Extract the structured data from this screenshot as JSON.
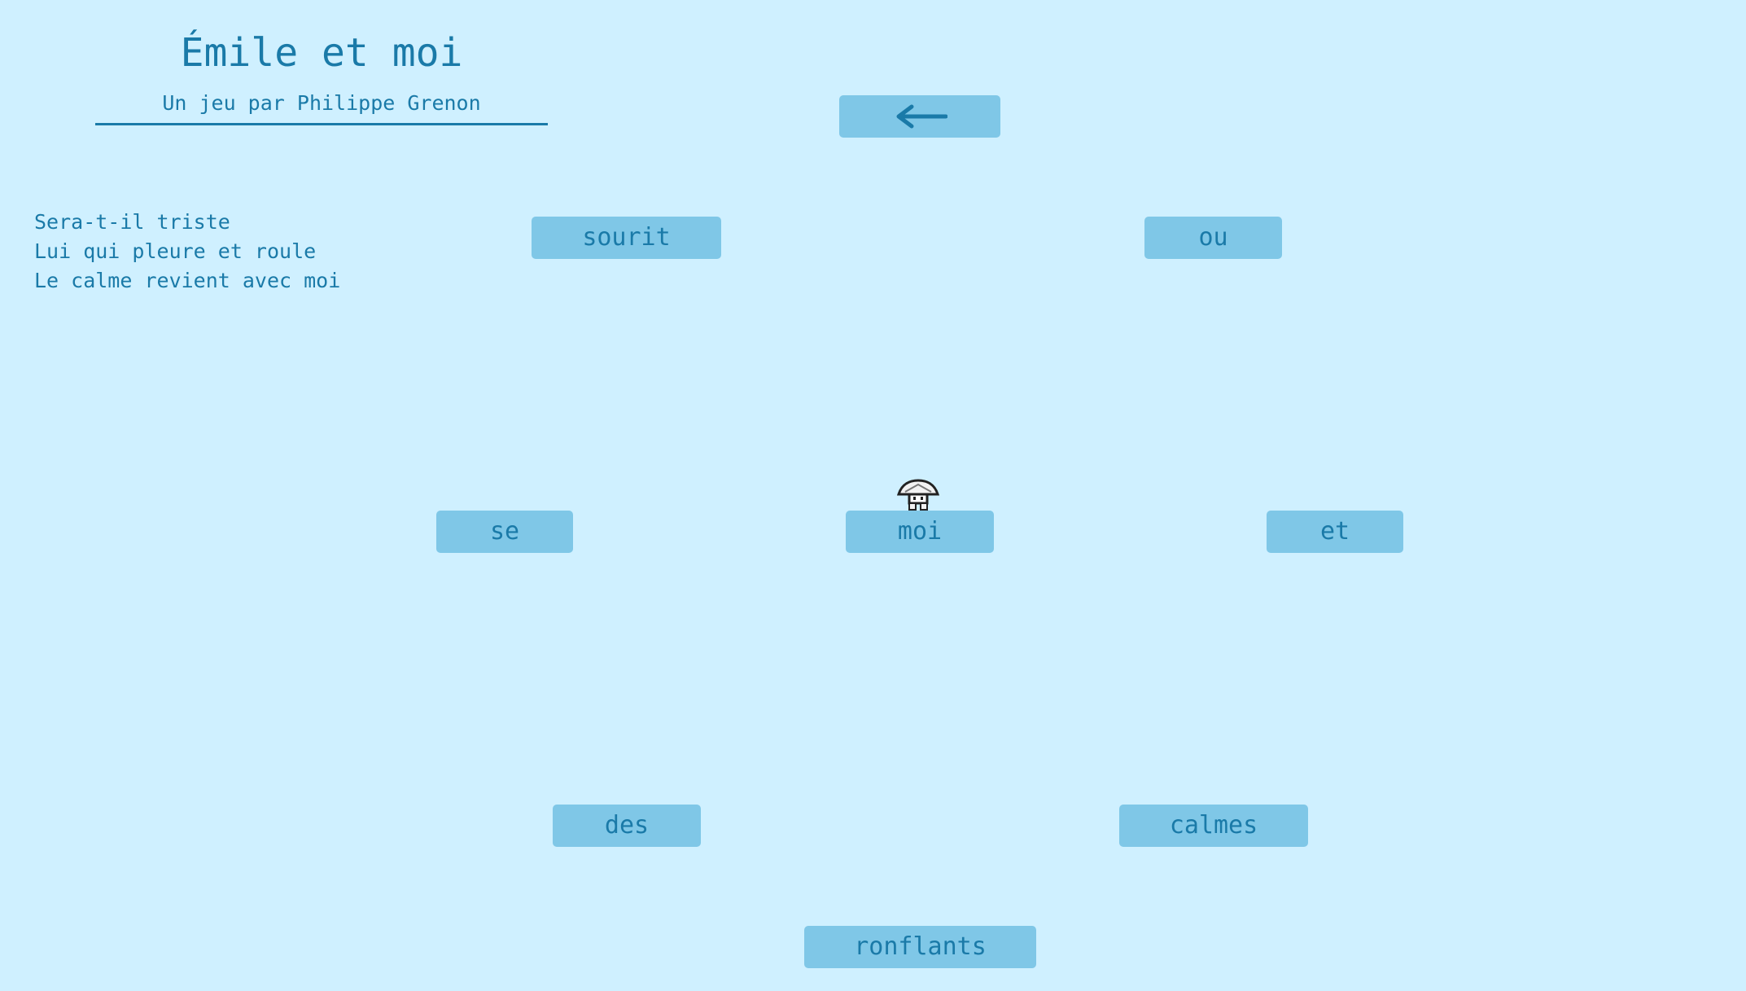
{
  "header": {
    "title": "Émile et moi",
    "subtitle": "Un jeu par Philippe Grenon"
  },
  "poem": {
    "lines": [
      "Sera-t-il triste",
      "Lui qui pleure et roule",
      "Le calme revient avec moi"
    ]
  },
  "controls": {
    "back_icon": "arrow-left-icon"
  },
  "words": {
    "sourit": "sourit",
    "ou": "ou",
    "se": "se",
    "moi": "moi",
    "et": "et",
    "des": "des",
    "calmes": "calmes",
    "ronflants": "ronflants"
  },
  "player": {
    "icon": "mushroom-character-icon"
  },
  "colors": {
    "background": "#cff0ff",
    "button": "#7fc7e7",
    "text": "#1a7aa8"
  }
}
